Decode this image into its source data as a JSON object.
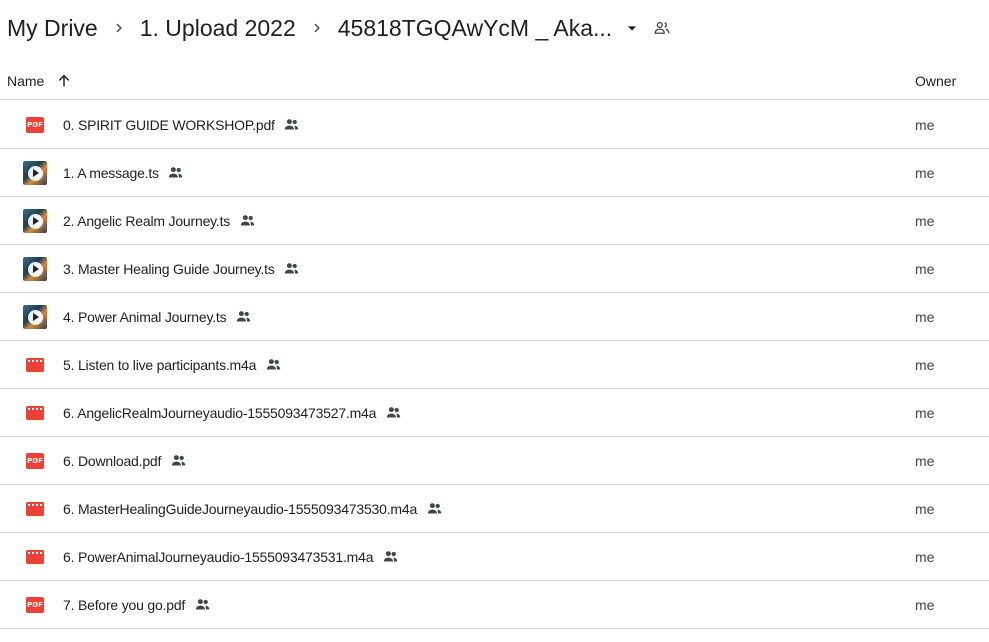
{
  "breadcrumb": {
    "items": [
      "My Drive",
      "1. Upload 2022",
      "45818TGQAwYcM _ Aka..."
    ],
    "icons": {
      "separator": "chevron-right-icon",
      "dropdown": "arrow-drop-down-icon",
      "shared_folder": "shared-folder-icon"
    }
  },
  "table": {
    "headers": {
      "name": "Name",
      "owner": "Owner"
    },
    "sort_icon": "arrow-upward-icon"
  },
  "files": [
    {
      "name": "0. SPIRIT GUIDE WORKSHOP.pdf",
      "type": "pdf",
      "owner": "me"
    },
    {
      "name": "1. A message.ts",
      "type": "video",
      "owner": "me"
    },
    {
      "name": "2. Angelic Realm Journey.ts",
      "type": "video",
      "owner": "me"
    },
    {
      "name": "3. Master Healing Guide Journey.ts",
      "type": "video",
      "owner": "me"
    },
    {
      "name": "4. Power Animal Journey.ts",
      "type": "video",
      "owner": "me"
    },
    {
      "name": "5. Listen to live participants.m4a",
      "type": "audio",
      "owner": "me"
    },
    {
      "name": "6. AngelicRealmJourneyaudio-1555093473527.m4a",
      "type": "audio",
      "owner": "me"
    },
    {
      "name": "6. Download.pdf",
      "type": "pdf",
      "owner": "me"
    },
    {
      "name": "6. MasterHealingGuideJourneyaudio-1555093473530.m4a",
      "type": "audio",
      "owner": "me"
    },
    {
      "name": "6. PowerAnimalJourneyaudio-1555093473531.m4a",
      "type": "audio",
      "owner": "me"
    },
    {
      "name": "7. Before you go.pdf",
      "type": "pdf",
      "owner": "me"
    }
  ],
  "pdf_badge_text": "PDF",
  "colors": {
    "accent_red": "#ea4335",
    "divider": "#dadce0",
    "text": "#1f1f1f",
    "secondary_text": "#444746"
  }
}
